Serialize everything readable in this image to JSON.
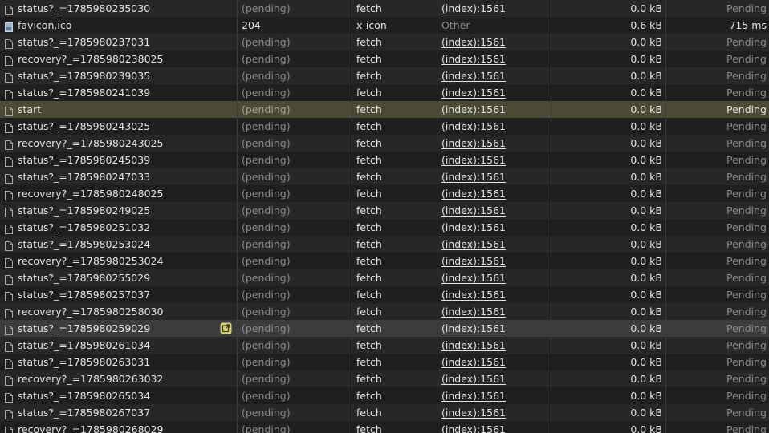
{
  "colors": {
    "background": "#212121",
    "row_even": "#1f1f1f",
    "row_odd": "#272727",
    "row_selected": "#4b4b35",
    "row_hovered": "#3c3c3c",
    "text": "#e3e3e3",
    "text_dim": "#8a8a8a",
    "badge": "#d6d27a"
  },
  "rows": [
    {
      "name": "status?_=1785980235030",
      "status": "(pending)",
      "type": "fetch",
      "initiator": "(index):1561",
      "size": "0.0 kB",
      "time": "Pending",
      "icon": "document-icon"
    },
    {
      "name": "favicon.ico",
      "status": "204",
      "type": "x-icon",
      "initiator": "Other",
      "size": "0.6 kB",
      "time": "715 ms",
      "icon": "image-file-icon",
      "done": true
    },
    {
      "name": "status?_=1785980237031",
      "status": "(pending)",
      "type": "fetch",
      "initiator": "(index):1561",
      "size": "0.0 kB",
      "time": "Pending",
      "icon": "document-icon"
    },
    {
      "name": "recovery?_=1785980238025",
      "status": "(pending)",
      "type": "fetch",
      "initiator": "(index):1561",
      "size": "0.0 kB",
      "time": "Pending",
      "icon": "document-icon"
    },
    {
      "name": "status?_=1785980239035",
      "status": "(pending)",
      "type": "fetch",
      "initiator": "(index):1561",
      "size": "0.0 kB",
      "time": "Pending",
      "icon": "document-icon"
    },
    {
      "name": "status?_=1785980241039",
      "status": "(pending)",
      "type": "fetch",
      "initiator": "(index):1561",
      "size": "0.0 kB",
      "time": "Pending",
      "icon": "document-icon"
    },
    {
      "name": "start",
      "status": "(pending)",
      "type": "fetch",
      "initiator": "(index):1561",
      "size": "0.0 kB",
      "time": "Pending",
      "icon": "document-icon",
      "selected": true
    },
    {
      "name": "status?_=1785980243025",
      "status": "(pending)",
      "type": "fetch",
      "initiator": "(index):1561",
      "size": "0.0 kB",
      "time": "Pending",
      "icon": "document-icon"
    },
    {
      "name": "recovery?_=1785980243025",
      "status": "(pending)",
      "type": "fetch",
      "initiator": "(index):1561",
      "size": "0.0 kB",
      "time": "Pending",
      "icon": "document-icon"
    },
    {
      "name": "status?_=1785980245039",
      "status": "(pending)",
      "type": "fetch",
      "initiator": "(index):1561",
      "size": "0.0 kB",
      "time": "Pending",
      "icon": "document-icon"
    },
    {
      "name": "status?_=1785980247033",
      "status": "(pending)",
      "type": "fetch",
      "initiator": "(index):1561",
      "size": "0.0 kB",
      "time": "Pending",
      "icon": "document-icon"
    },
    {
      "name": "recovery?_=1785980248025",
      "status": "(pending)",
      "type": "fetch",
      "initiator": "(index):1561",
      "size": "0.0 kB",
      "time": "Pending",
      "icon": "document-icon"
    },
    {
      "name": "status?_=1785980249025",
      "status": "(pending)",
      "type": "fetch",
      "initiator": "(index):1561",
      "size": "0.0 kB",
      "time": "Pending",
      "icon": "document-icon"
    },
    {
      "name": "status?_=1785980251032",
      "status": "(pending)",
      "type": "fetch",
      "initiator": "(index):1561",
      "size": "0.0 kB",
      "time": "Pending",
      "icon": "document-icon"
    },
    {
      "name": "status?_=1785980253024",
      "status": "(pending)",
      "type": "fetch",
      "initiator": "(index):1561",
      "size": "0.0 kB",
      "time": "Pending",
      "icon": "document-icon"
    },
    {
      "name": "recovery?_=1785980253024",
      "status": "(pending)",
      "type": "fetch",
      "initiator": "(index):1561",
      "size": "0.0 kB",
      "time": "Pending",
      "icon": "document-icon"
    },
    {
      "name": "status?_=1785980255029",
      "status": "(pending)",
      "type": "fetch",
      "initiator": "(index):1561",
      "size": "0.0 kB",
      "time": "Pending",
      "icon": "document-icon"
    },
    {
      "name": "status?_=1785980257037",
      "status": "(pending)",
      "type": "fetch",
      "initiator": "(index):1561",
      "size": "0.0 kB",
      "time": "Pending",
      "icon": "document-icon"
    },
    {
      "name": "recovery?_=1785980258030",
      "status": "(pending)",
      "type": "fetch",
      "initiator": "(index):1561",
      "size": "0.0 kB",
      "time": "Pending",
      "icon": "document-icon"
    },
    {
      "name": "status?_=1785980259029",
      "status": "(pending)",
      "type": "fetch",
      "initiator": "(index):1561",
      "size": "0.0 kB",
      "time": "Pending",
      "icon": "document-icon",
      "hovered": true,
      "badge": "override-badge-icon"
    },
    {
      "name": "status?_=1785980261034",
      "status": "(pending)",
      "type": "fetch",
      "initiator": "(index):1561",
      "size": "0.0 kB",
      "time": "Pending",
      "icon": "document-icon"
    },
    {
      "name": "status?_=1785980263031",
      "status": "(pending)",
      "type": "fetch",
      "initiator": "(index):1561",
      "size": "0.0 kB",
      "time": "Pending",
      "icon": "document-icon"
    },
    {
      "name": "recovery?_=1785980263032",
      "status": "(pending)",
      "type": "fetch",
      "initiator": "(index):1561",
      "size": "0.0 kB",
      "time": "Pending",
      "icon": "document-icon"
    },
    {
      "name": "status?_=1785980265034",
      "status": "(pending)",
      "type": "fetch",
      "initiator": "(index):1561",
      "size": "0.0 kB",
      "time": "Pending",
      "icon": "document-icon"
    },
    {
      "name": "status?_=1785980267037",
      "status": "(pending)",
      "type": "fetch",
      "initiator": "(index):1561",
      "size": "0.0 kB",
      "time": "Pending",
      "icon": "document-icon"
    },
    {
      "name": "recovery?_=1785980268029",
      "status": "(pending)",
      "type": "fetch",
      "initiator": "(index):1561",
      "size": "0.0 kB",
      "time": "Pending",
      "icon": "document-icon"
    }
  ]
}
